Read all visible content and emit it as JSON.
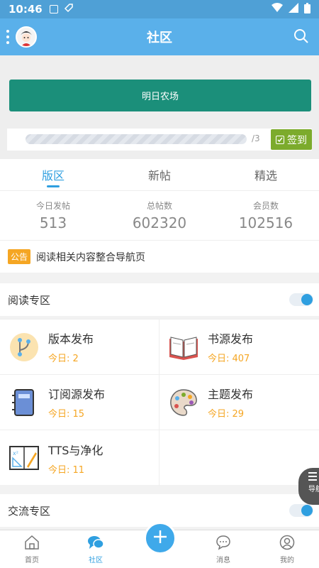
{
  "status": {
    "time": "10:46"
  },
  "appbar": {
    "title": "社区"
  },
  "banner": {
    "label": "明日农场"
  },
  "signin": {
    "progress_label": "/3",
    "progress_fraction": 0.0,
    "button_label": "签到"
  },
  "tabs": [
    {
      "label": "版区",
      "active": true
    },
    {
      "label": "新帖",
      "active": false
    },
    {
      "label": "精选",
      "active": false
    }
  ],
  "stats": [
    {
      "label": "今日发帖",
      "value": "513"
    },
    {
      "label": "总帖数",
      "value": "602320"
    },
    {
      "label": "会员数",
      "value": "102516"
    }
  ],
  "notice": {
    "tag": "公告",
    "text": "阅读相关内容整合导航页"
  },
  "sections": [
    {
      "title": "阅读专区",
      "toggle_on": true
    },
    {
      "title": "交流专区",
      "toggle_on": true
    }
  ],
  "boards": [
    {
      "name": "版本发布",
      "today": "今日: 2",
      "icon": "version-branch-icon"
    },
    {
      "name": "书源发布",
      "today": "今日: 407",
      "icon": "open-book-icon"
    },
    {
      "name": "订阅源发布",
      "today": "今日: 15",
      "icon": "notebook-icon"
    },
    {
      "name": "主题发布",
      "today": "今日: 29",
      "icon": "palette-icon"
    },
    {
      "name": "TTS与净化",
      "today": "今日: 11",
      "icon": "math-tools-icon"
    }
  ],
  "side_button": {
    "label": "导航"
  },
  "bottom_nav": [
    {
      "label": "首页",
      "icon": "home-icon"
    },
    {
      "label": "社区",
      "icon": "chat-icon",
      "active": true
    },
    {
      "label": "消息",
      "icon": "message-icon"
    },
    {
      "label": "我的",
      "icon": "profile-icon"
    }
  ],
  "colors": {
    "accent": "#5ab0ea",
    "active": "#2f9fe0",
    "banner": "#1b8f7a",
    "signin": "#7cab2c",
    "badge": "#f5a623"
  }
}
